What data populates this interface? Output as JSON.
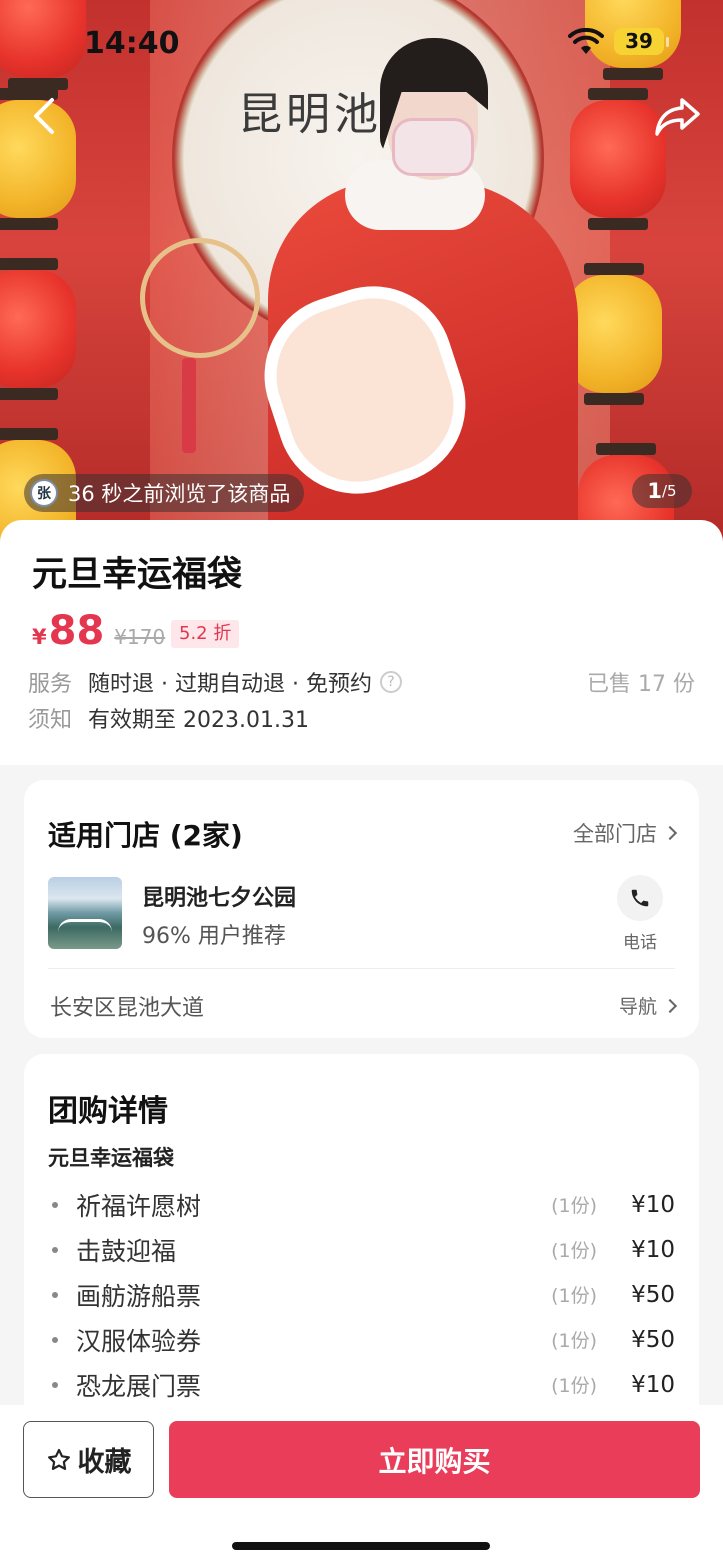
{
  "status_bar": {
    "time": "14:40",
    "battery": "39",
    "wifi_icon": "wifi-icon"
  },
  "hero": {
    "drum_text": "昆明池",
    "viewed_avatar": "张",
    "viewed_text": "36 秒之前浏览了该商品",
    "page_current": "1",
    "page_total": "/5"
  },
  "product": {
    "title": "元旦幸运福袋",
    "currency": "¥",
    "price": "88",
    "original_price": "¥170",
    "discount": "5.2 折",
    "service_label": "服务",
    "service_value": "随时退 · 过期自动退 · 免预约",
    "sold": "已售 17 份",
    "notice_label": "须知",
    "notice_value": "有效期至 2023.01.31"
  },
  "stores": {
    "heading": "适用门店 (2家)",
    "all_link": "全部门店",
    "store_name": "昆明池七夕公园",
    "recommend": "96% 用户推荐",
    "phone_label": "电话",
    "address": "长安区昆池大道",
    "nav_label": "导航"
  },
  "deal": {
    "heading": "团购详情",
    "subheading": "元旦幸运福袋",
    "items": [
      {
        "name": "祈福许愿树",
        "qty": "(1份)",
        "price": "¥10"
      },
      {
        "name": "击鼓迎福",
        "qty": "(1份)",
        "price": "¥10"
      },
      {
        "name": "画舫游船票",
        "qty": "(1份)",
        "price": "¥50"
      },
      {
        "name": "汉服体验券",
        "qty": "(1份)",
        "price": "¥50"
      },
      {
        "name": "恐龙展门票",
        "qty": "(1份)",
        "price": "¥10"
      }
    ]
  },
  "bottom_bar": {
    "favorite": "收藏",
    "buy": "立即购买"
  },
  "colors": {
    "accent": "#e93d5a",
    "price": "#e5364f",
    "battery": "#f7d233"
  }
}
